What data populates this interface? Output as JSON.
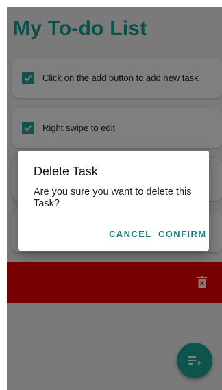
{
  "app": {
    "title": "My To-do List"
  },
  "tasks": [
    {
      "label": "Click on the add button to add new task",
      "checked": true
    },
    {
      "label": "Right swipe to edit",
      "checked": true
    },
    {
      "label": "",
      "checked": true
    },
    {
      "label": "",
      "checked": true
    }
  ],
  "swipe_row": {
    "action_icon": "trash-icon",
    "color": "#ee0000"
  },
  "fab": {
    "icon": "playlist-add-icon",
    "color": "#1aa998"
  },
  "dialog": {
    "title": "Delete Task",
    "message": "Are you sure you want to delete this Task?",
    "cancel_label": "CANCEL",
    "confirm_label": "CONFIRM"
  },
  "colors": {
    "accent": "#0fa497",
    "checkbox": "#22a699",
    "button_text": "#127f7f"
  }
}
